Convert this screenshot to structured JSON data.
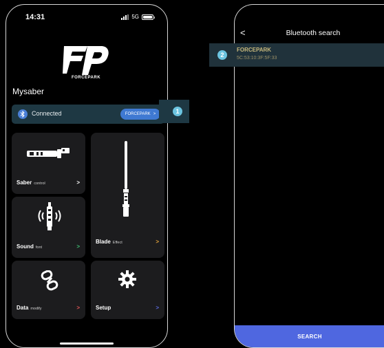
{
  "left_screen": {
    "status": {
      "time": "14:31",
      "network": "5G"
    },
    "brand": {
      "logo_text": "FORCEPARK"
    },
    "section_title": "Mysaber",
    "connection": {
      "status_label": "Connected",
      "device_label": "FORCEPARK",
      "arrow": ">"
    },
    "tiles": {
      "saber": {
        "title": "Saber",
        "subtitle": "control",
        "arrow": ">",
        "arrow_color": "#ffffff"
      },
      "blade": {
        "title": "Blade",
        "subtitle": "Effect",
        "arrow": ">",
        "arrow_color": "#e3a33a"
      },
      "sound": {
        "title": "Sound",
        "subtitle": "font",
        "arrow": ">",
        "arrow_color": "#3fbf73"
      },
      "data": {
        "title": "Data",
        "subtitle": "modify",
        "arrow": ">",
        "arrow_color": "#e05555"
      },
      "setup": {
        "title": "Setup",
        "subtitle": "",
        "arrow": ">",
        "arrow_color": "#5b6be0"
      }
    }
  },
  "right_screen": {
    "back_label": "<",
    "title": "Bluetooth search",
    "devices": [
      {
        "name": "FORCEPARK",
        "mac": "5C:53:10:3F:5F:33"
      }
    ],
    "search_button": "SEARCH"
  },
  "callouts": [
    "1",
    "2"
  ],
  "colors": {
    "accent_blue": "#3f79d2",
    "connected_bg": "#1e3843",
    "tile_bg": "#1c1c1e",
    "search_button": "#4f67e0",
    "callout": "#6cc4e0",
    "device_name": "#c8b97c"
  },
  "icons": {
    "bluetooth": "bluetooth-icon",
    "saber": "lightsaber-hilt-icon",
    "blade": "lightsaber-blade-icon",
    "sound": "sound-waves-hilt-icon",
    "data": "link-chain-icon",
    "setup": "gear-icon"
  }
}
